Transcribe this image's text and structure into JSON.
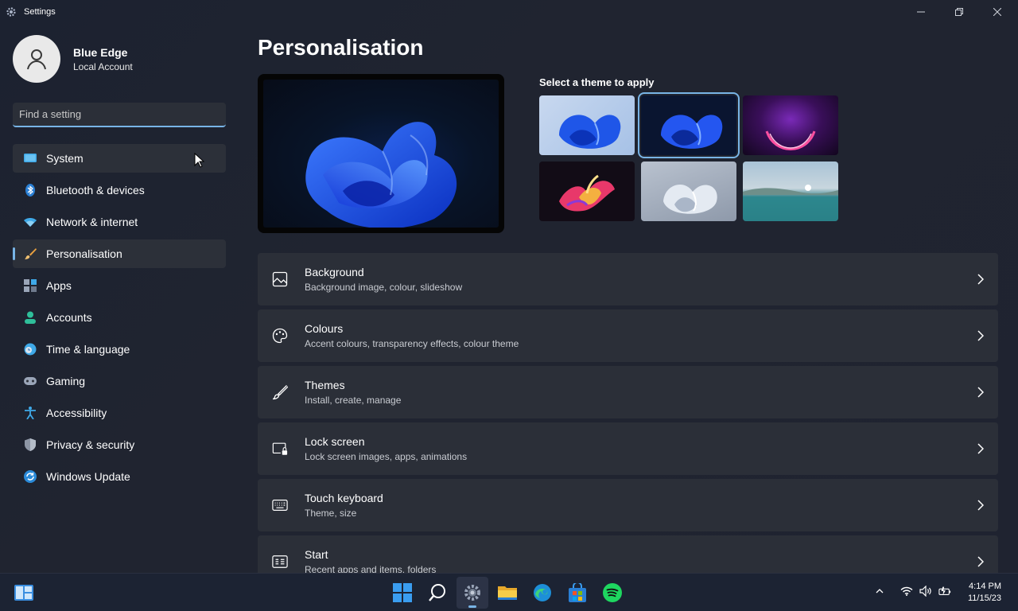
{
  "window": {
    "title": "Settings"
  },
  "profile": {
    "name": "Blue Edge",
    "account_type": "Local Account"
  },
  "search": {
    "placeholder": "Find a setting",
    "value": ""
  },
  "nav": {
    "items": [
      {
        "label": "System",
        "icon": "monitor-icon"
      },
      {
        "label": "Bluetooth & devices",
        "icon": "bluetooth-icon"
      },
      {
        "label": "Network & internet",
        "icon": "wifi-icon"
      },
      {
        "label": "Personalisation",
        "icon": "brush-icon"
      },
      {
        "label": "Apps",
        "icon": "apps-icon"
      },
      {
        "label": "Accounts",
        "icon": "person-icon"
      },
      {
        "label": "Time & language",
        "icon": "clock-globe-icon"
      },
      {
        "label": "Gaming",
        "icon": "gamepad-icon"
      },
      {
        "label": "Accessibility",
        "icon": "accessibility-icon"
      },
      {
        "label": "Privacy & security",
        "icon": "shield-icon"
      },
      {
        "label": "Windows Update",
        "icon": "update-icon"
      }
    ],
    "active": "Personalisation",
    "hovered": "System"
  },
  "main": {
    "title": "Personalisation",
    "theme_heading": "Select a theme to apply",
    "themes": [
      {
        "name": "windows-light",
        "selected": false
      },
      {
        "name": "windows-dark",
        "selected": true
      },
      {
        "name": "glow",
        "selected": false
      },
      {
        "name": "captured-motion",
        "selected": false
      },
      {
        "name": "sunrise",
        "selected": false
      },
      {
        "name": "flow",
        "selected": false
      }
    ],
    "cards": [
      {
        "title": "Background",
        "subtitle": "Background image, colour, slideshow",
        "icon": "image-icon"
      },
      {
        "title": "Colours",
        "subtitle": "Accent colours, transparency effects, colour theme",
        "icon": "palette-icon"
      },
      {
        "title": "Themes",
        "subtitle": "Install, create, manage",
        "icon": "brush-icon"
      },
      {
        "title": "Lock screen",
        "subtitle": "Lock screen images, apps, animations",
        "icon": "lock-screen-icon"
      },
      {
        "title": "Touch keyboard",
        "subtitle": "Theme, size",
        "icon": "keyboard-icon"
      },
      {
        "title": "Start",
        "subtitle": "Recent apps and items, folders",
        "icon": "start-icon"
      }
    ]
  },
  "taskbar": {
    "apps": [
      "windows-start-icon",
      "search-icon",
      "settings-icon",
      "file-explorer-icon",
      "edge-icon",
      "store-icon",
      "spotify-icon"
    ],
    "active_app": "settings-icon",
    "tray": [
      "chevron-up-icon",
      "wifi-icon",
      "volume-icon",
      "battery-icon"
    ],
    "time": "4:14 PM",
    "date": "11/15/23"
  },
  "colors": {
    "accent": "#78b4e6",
    "window_bg": "#202430",
    "card_bg": "#2b2f38",
    "taskbar_bg": "#1c2333"
  }
}
